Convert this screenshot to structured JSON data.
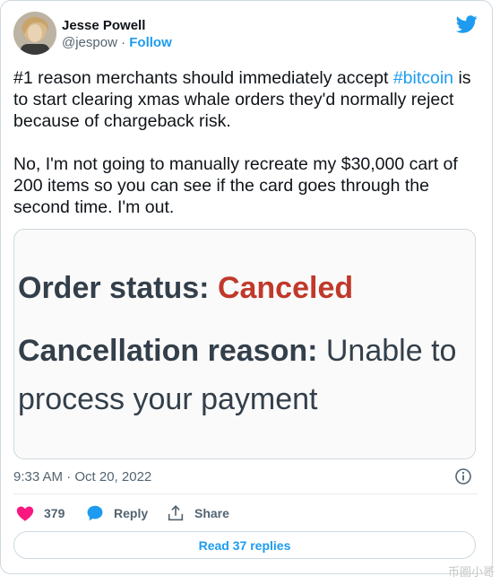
{
  "author": {
    "display_name": "Jesse Powell",
    "handle": "@jespow",
    "separator": " · ",
    "follow_label": "Follow"
  },
  "tweet": {
    "text_before_hashtag": "#1 reason merchants should immediately accept ",
    "hashtag": "#bitcoin",
    "text_after_hashtag": " is to start clearing xmas whale orders they'd normally reject because of chargeback risk.\n\nNo, I'm not going to manually recreate my $30,000 cart of 200 items so you can see if the card goes through the second time. I'm out."
  },
  "media": {
    "status_label": "Order status: ",
    "status_value": "Canceled",
    "reason_label": "Cancellation reason: ",
    "reason_value": "Unable to process your payment"
  },
  "meta": {
    "timestamp": "9:33 AM · Oct 20, 2022"
  },
  "actions": {
    "like_count": "379",
    "reply_label": "Reply",
    "share_label": "Share"
  },
  "read_replies_label": "Read 37 replies",
  "watermark": "币圈小哥",
  "colors": {
    "accent": "#1d9bf0",
    "like": "#f91880",
    "canceled": "#c0392b",
    "text": "#0f1419",
    "muted": "#536471"
  },
  "icons": [
    "twitter-logo-icon",
    "heart-icon",
    "reply-bubble-icon",
    "share-icon",
    "info-icon"
  ]
}
